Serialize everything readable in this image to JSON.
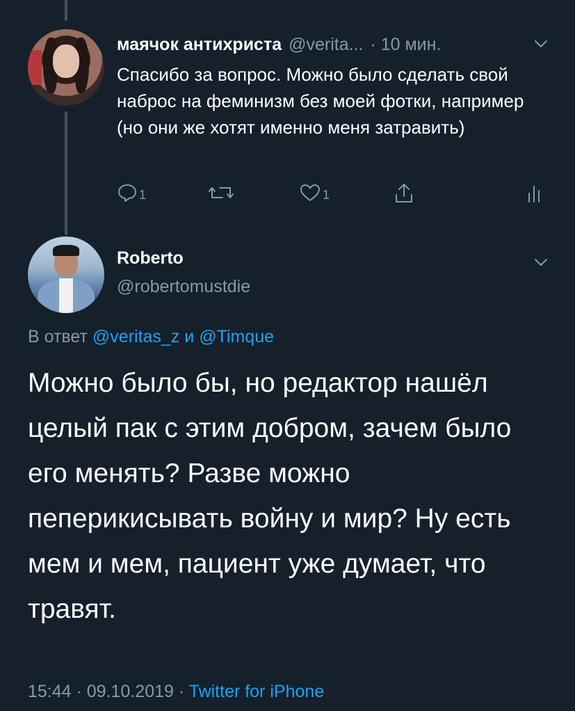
{
  "tweet1": {
    "name": "маячок антихриста",
    "handle": "@verita...",
    "time": "· 10 мин.",
    "text": "Спасибо за вопрос. Можно было сделать свой наброс на феминизм без моей фотки, например (но они же хотят именно меня затравить)",
    "reply_count": "1",
    "retweet_count": "",
    "like_count": "1"
  },
  "tweet2": {
    "name": "Roberto",
    "handle": "@robertomustdie",
    "reply_prefix": "В ответ",
    "reply_mention_1": "@veritas_z",
    "reply_conj": "и",
    "reply_mention_2": "@Timque",
    "text": "Можно было бы, но редактор нашёл целый пак с этим добром, зачем было его менять? Разве можно пеперикисывать войну и мир? Ну есть мем и мем, пациент уже думает, что травят.",
    "timestamp": "15:44 · 09.10.2019 ·",
    "source": "Twitter for iPhone"
  },
  "colors": {
    "background": "#15202b",
    "secondary_text": "#8899a6",
    "accent": "#1da1f2",
    "thread_line": "#3d5466"
  },
  "icons": [
    "reply-icon",
    "retweet-icon",
    "like-icon",
    "share-icon",
    "analytics-icon",
    "chevron-down-icon"
  ]
}
